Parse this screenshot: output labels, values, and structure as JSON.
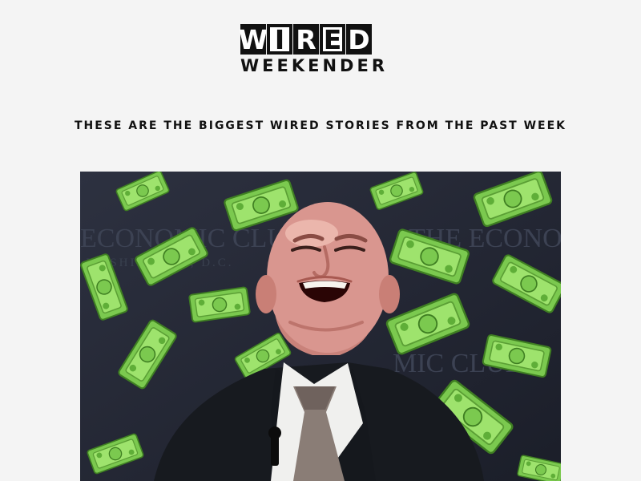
{
  "logo": {
    "letters": [
      "W",
      "I",
      "R",
      "E",
      "D"
    ],
    "subtitle": "WEEKENDER"
  },
  "headline": "THESE ARE THE BIGGEST WIRED STORIES FROM THE PAST WEEK",
  "hero": {
    "background_text": [
      "ECONOMIC CLUB",
      "THE ECONOMIC",
      "MIC CLUB",
      "WASHINGTON, D.C."
    ]
  },
  "colors": {
    "page_bg": "#f4f4f4",
    "ink": "#111111",
    "hero_bg": "#242735",
    "cash": "#8fdc5a"
  }
}
